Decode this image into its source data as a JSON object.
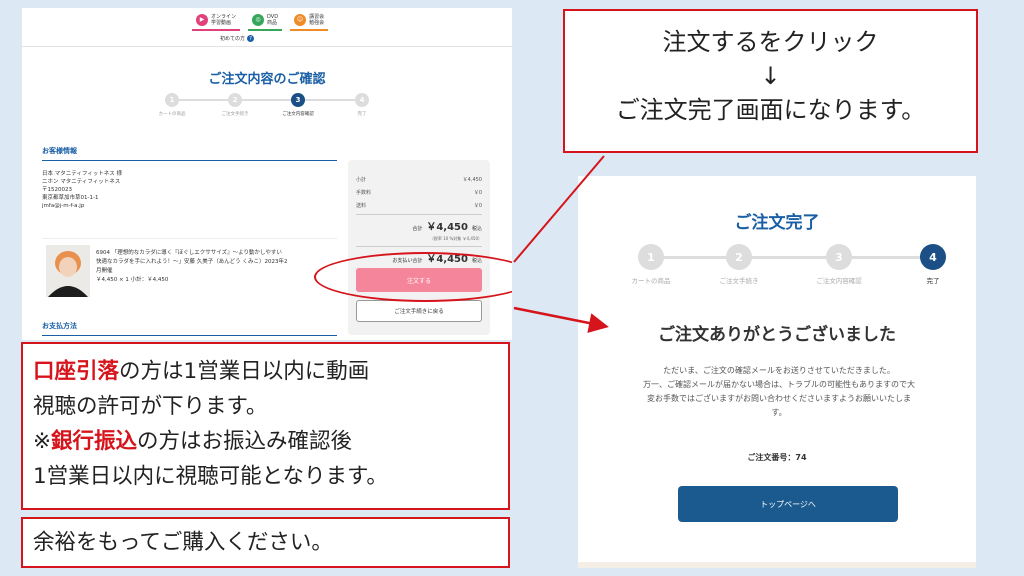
{
  "left_panel": {
    "nav": [
      {
        "line1": "オンライン",
        "line2": "学習動画"
      },
      {
        "line1": "DVD",
        "line2": "商品"
      },
      {
        "line1": "講習会",
        "line2": "勉強会"
      }
    ],
    "beginner_label": "初めての方",
    "title": "ご注文内容のご確認",
    "steps": [
      {
        "num": "1",
        "label": "カートの商品"
      },
      {
        "num": "2",
        "label": "ご注文手続き"
      },
      {
        "num": "3",
        "label": "ご注文内容確認"
      },
      {
        "num": "4",
        "label": "完了"
      }
    ],
    "customer_section": "お客様情報",
    "customer": {
      "line1": "日本 マタニティフィットネス 様",
      "line2": "ニホン マタニティフィットネス",
      "zip": "〒1520023",
      "address": "東京都草加市草01-1-1",
      "email": "jmfa@j-m-f-a.jp"
    },
    "product": {
      "line1": "6904 「理想的なカラダに導く『ほぐしエクササイズ』～より動かしやすい",
      "line2": "快適なカラダを手に入れよう！～」安藤 久美子（あんどう くみこ）2023年2",
      "line3": "月開催",
      "line4": "￥4,450 × 1  小計：￥4,450"
    },
    "payment_section": "お支払方法",
    "summary": {
      "subtotal_label": "小計",
      "subtotal": "￥4,450",
      "fee_label": "手数料",
      "fee": "￥0",
      "shipping_label": "送料",
      "shipping": "￥0",
      "total_label": "合計",
      "total": "￥4,450",
      "tax_in": "税込",
      "tax_note": "（税率 10 %対象 ￥4,450）",
      "pay_label": "お支払い合計",
      "pay_total": "￥4,450",
      "pay_tax_in": "税込"
    },
    "order_button": "注文する",
    "back_button": "ご注文手続きに戻る"
  },
  "callout_click": {
    "line1": "注文するをクリック",
    "line2": "↓",
    "line3": "ご注文完了画面になります。"
  },
  "callout_transfer": {
    "l1_red": "口座引落",
    "l1_rest": "の方は1営業日以内に動画",
    "l2": "視聴の許可が下ります。",
    "l3_pre": "※",
    "l3_red": "銀行振込",
    "l3_rest": "の方はお振込み確認後",
    "l4": "1営業日以内に視聴可能となります。"
  },
  "callout_spare": "余裕をもってご購入ください。",
  "right_panel": {
    "title": "ご注文完了",
    "steps": [
      {
        "num": "1",
        "label": "カートの商品"
      },
      {
        "num": "2",
        "label": "ご注文手続き"
      },
      {
        "num": "3",
        "label": "ご注文内容確認"
      },
      {
        "num": "4",
        "label": "完了"
      }
    ],
    "thanks": "ご注文ありがとうございました",
    "message_l1": "ただいま、ご注文の確認メールをお送りさせていただきました。",
    "message_l2": "万一、ご確認メールが届かない場合は、トラブルの可能性もありますので大",
    "message_l3": "変お手数ではございますがお問い合わせくださいますようお願いいたしま",
    "message_l4": "す。",
    "order_number_label": "ご注文番号：74",
    "top_button": "トップページへ"
  },
  "colors": {
    "accent_red": "#d6141b",
    "brand_blue": "#1a5fa5",
    "order_pink": "#f4859a"
  }
}
